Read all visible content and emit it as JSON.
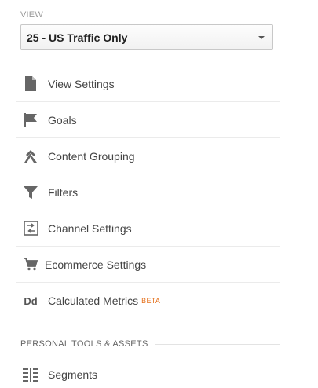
{
  "view": {
    "label": "VIEW",
    "selected": "25 - US Traffic Only"
  },
  "menu": {
    "items": [
      {
        "label": "View Settings",
        "icon": "document-icon"
      },
      {
        "label": "Goals",
        "icon": "flag-icon"
      },
      {
        "label": "Content Grouping",
        "icon": "content-grouping-icon"
      },
      {
        "label": "Filters",
        "icon": "filter-icon"
      },
      {
        "label": "Channel Settings",
        "icon": "channel-settings-icon"
      },
      {
        "label": "Ecommerce Settings",
        "icon": "cart-icon"
      },
      {
        "label": "Calculated Metrics",
        "icon": "calculated-metrics-icon",
        "icon_text": "Dd",
        "badge": "BETA"
      }
    ]
  },
  "personal_tools": {
    "header": "PERSONAL TOOLS & ASSETS",
    "items": [
      {
        "label": "Segments",
        "icon": "segments-icon"
      }
    ]
  },
  "colors": {
    "icon": "#666666",
    "beta": "#e5711d",
    "text": "#444444",
    "muted": "#999999"
  }
}
